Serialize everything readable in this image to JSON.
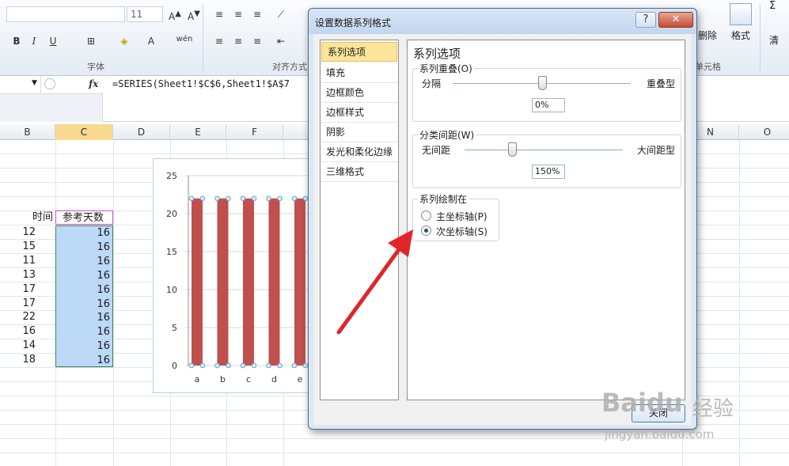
{
  "ribbon": {
    "font_size": "11",
    "group_font": "字体",
    "group_align": "对齐方式",
    "group_cells": "单元格",
    "delete_label": "删除",
    "format_label": "格式",
    "sigma": "Σ",
    "clear_partial": "清"
  },
  "formula_bar": {
    "fx_label": "fx",
    "formula": "=SERIES(Sheet1!$C$6,Sheet1!$A$7"
  },
  "columns": [
    "B",
    "C",
    "D",
    "E",
    "F",
    "N",
    "O"
  ],
  "sheet": {
    "header_time": "时间",
    "header_days": "参考天数",
    "time_values": [
      "12",
      "15",
      "11",
      "13",
      "17",
      "17",
      "22",
      "16",
      "14",
      "18"
    ],
    "day_values": [
      "16",
      "16",
      "16",
      "16",
      "16",
      "16",
      "16",
      "16",
      "16",
      "16"
    ]
  },
  "chart_data": {
    "type": "bar",
    "categories": [
      "a",
      "b",
      "c",
      "d",
      "e"
    ],
    "values": [
      22,
      22,
      22,
      22,
      22
    ],
    "ylim": [
      0,
      25
    ],
    "yticks": [
      "25",
      "20",
      "15",
      "10",
      "5",
      "0"
    ]
  },
  "dialog": {
    "title": "设置数据系列格式",
    "help_label": "?",
    "close_label": "✕",
    "nav_items": [
      "系列选项",
      "填充",
      "边框颜色",
      "边框样式",
      "阴影",
      "发光和柔化边缘",
      "三维格式"
    ],
    "content_title": "系列选项",
    "overlap": {
      "legend": "系列重叠(O)",
      "left_label": "分隔",
      "right_label": "重叠型",
      "value": "0%",
      "level": 0.5
    },
    "gap": {
      "legend": "分类间距(W)",
      "left_label": "无间距",
      "right_label": "大间距型",
      "value": "150%",
      "level": 0.3
    },
    "plot_on": {
      "legend": "系列绘制在",
      "primary": "主坐标轴(P)",
      "secondary": "次坐标轴(S)",
      "selected": "secondary"
    },
    "close_button": "关闭"
  },
  "watermark": {
    "brand": "Baidu",
    "cn": "经验",
    "url": "jingyan.baidu.com"
  },
  "colors": {
    "bar": "#c0504d",
    "arrow": "#e0262a",
    "selection": "#bcd9f7"
  }
}
